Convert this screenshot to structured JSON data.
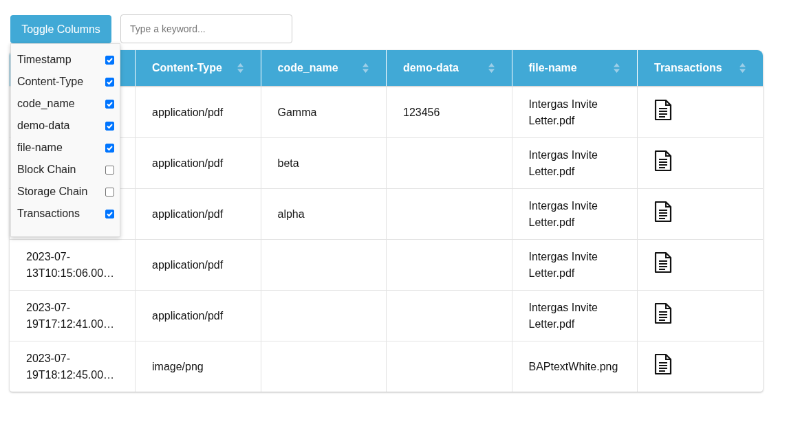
{
  "toolbar": {
    "toggle_button": "Toggle Columns",
    "search": {
      "placeholder": "Type a keyword..."
    }
  },
  "column_menu": [
    {
      "label": "Timestamp",
      "checked": true
    },
    {
      "label": "Content-Type",
      "checked": true
    },
    {
      "label": "code_name",
      "checked": true
    },
    {
      "label": "demo-data",
      "checked": true
    },
    {
      "label": "file-name",
      "checked": true
    },
    {
      "label": "Block Chain",
      "checked": false
    },
    {
      "label": "Storage Chain",
      "checked": false
    },
    {
      "label": "Transactions",
      "checked": true
    }
  ],
  "table": {
    "columns": [
      {
        "label": "Content-Type"
      },
      {
        "label": "code_name"
      },
      {
        "label": "demo-data"
      },
      {
        "label": "file-name"
      },
      {
        "label": "Transactions"
      }
    ],
    "rows": [
      {
        "content_type": "application/pdf",
        "code_name": "Gamma",
        "demo_data": "123456",
        "file_name": "Intergas Invite Letter.pdf"
      },
      {
        "content_type": "application/pdf",
        "code_name": "beta",
        "file_name": "Intergas Invite Letter.pdf"
      },
      {
        "content_type": "application/pdf",
        "code_name": "alpha",
        "file_name": "Intergas Invite Letter.pdf"
      },
      {
        "timestamp": "2023-07-13T10:15:06.00…",
        "content_type": "application/pdf",
        "file_name": "Intergas Invite Letter.pdf"
      },
      {
        "timestamp": "2023-07-19T17:12:41.00…",
        "content_type": "application/pdf",
        "file_name": "Intergas Invite Letter.pdf"
      },
      {
        "timestamp": "2023-07-19T18:12:45.00…",
        "content_type": "image/png",
        "file_name": "BAPtextWhite.png"
      }
    ]
  }
}
